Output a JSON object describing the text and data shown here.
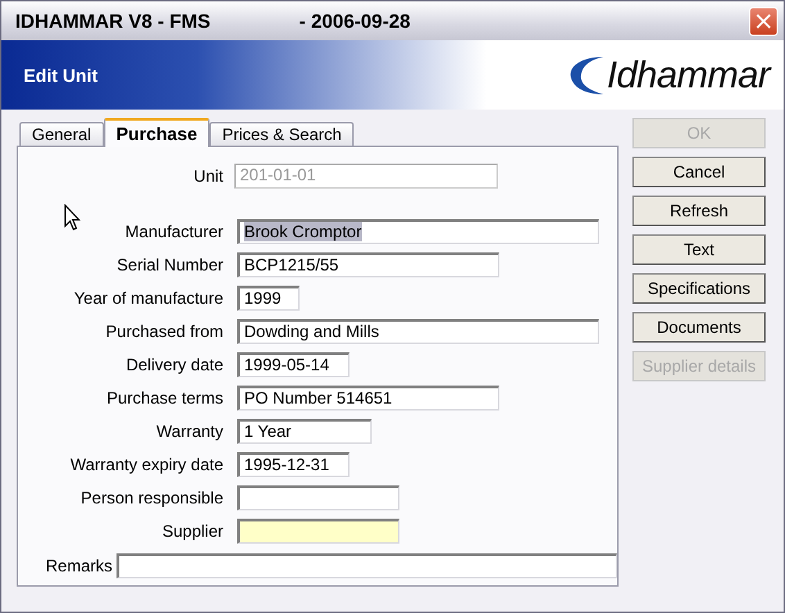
{
  "window": {
    "title": "IDHAMMAR V8 - FMS",
    "date": "- 2006-09-28",
    "close": "×"
  },
  "header": {
    "title": "Edit Unit",
    "logo": "Idhammar"
  },
  "tabs": [
    {
      "label": "General",
      "selected": false
    },
    {
      "label": "Purchase",
      "selected": true
    },
    {
      "label": "Prices & Search",
      "selected": false
    }
  ],
  "fields": [
    {
      "label": "Unit",
      "value": "201-01-01",
      "disabled": true,
      "text_selected": false,
      "highlighted": false
    },
    {
      "label": "Manufacturer",
      "value": "Brook Cromptor",
      "disabled": false,
      "text_selected": true,
      "highlighted": false
    },
    {
      "label": "Serial Number",
      "value": "BCP1215/55",
      "disabled": false,
      "text_selected": false,
      "highlighted": false
    },
    {
      "label": "Year of manufacture",
      "value": "1999",
      "disabled": false,
      "text_selected": false,
      "highlighted": false
    },
    {
      "label": "Purchased from",
      "value": "Dowding and Mills",
      "disabled": false,
      "text_selected": false,
      "highlighted": false
    },
    {
      "label": "Delivery date",
      "value": "1999-05-14",
      "disabled": false,
      "text_selected": false,
      "highlighted": false
    },
    {
      "label": "Purchase terms",
      "value": "PO Number 514651",
      "disabled": false,
      "text_selected": false,
      "highlighted": false
    },
    {
      "label": "Warranty",
      "value": "1 Year",
      "disabled": false,
      "text_selected": false,
      "highlighted": false
    },
    {
      "label": "Warranty expiry date",
      "value": "1995-12-31",
      "disabled": false,
      "text_selected": false,
      "highlighted": false
    },
    {
      "label": "Person responsible",
      "disabled": false,
      "highlighted": false
    },
    {
      "label": "Supplier",
      "disabled": false,
      "highlighted": true
    }
  ],
  "remarks": {
    "label": "Remarks"
  },
  "buttons": [
    {
      "label": "OK",
      "disabled": true
    },
    {
      "label": "Cancel",
      "disabled": false
    },
    {
      "label": "Refresh",
      "disabled": false
    },
    {
      "label": "Text",
      "disabled": false
    },
    {
      "label": "Specifications",
      "disabled": false
    },
    {
      "label": "Documents",
      "disabled": false
    },
    {
      "label": "Supplier details",
      "disabled": true
    }
  ]
}
